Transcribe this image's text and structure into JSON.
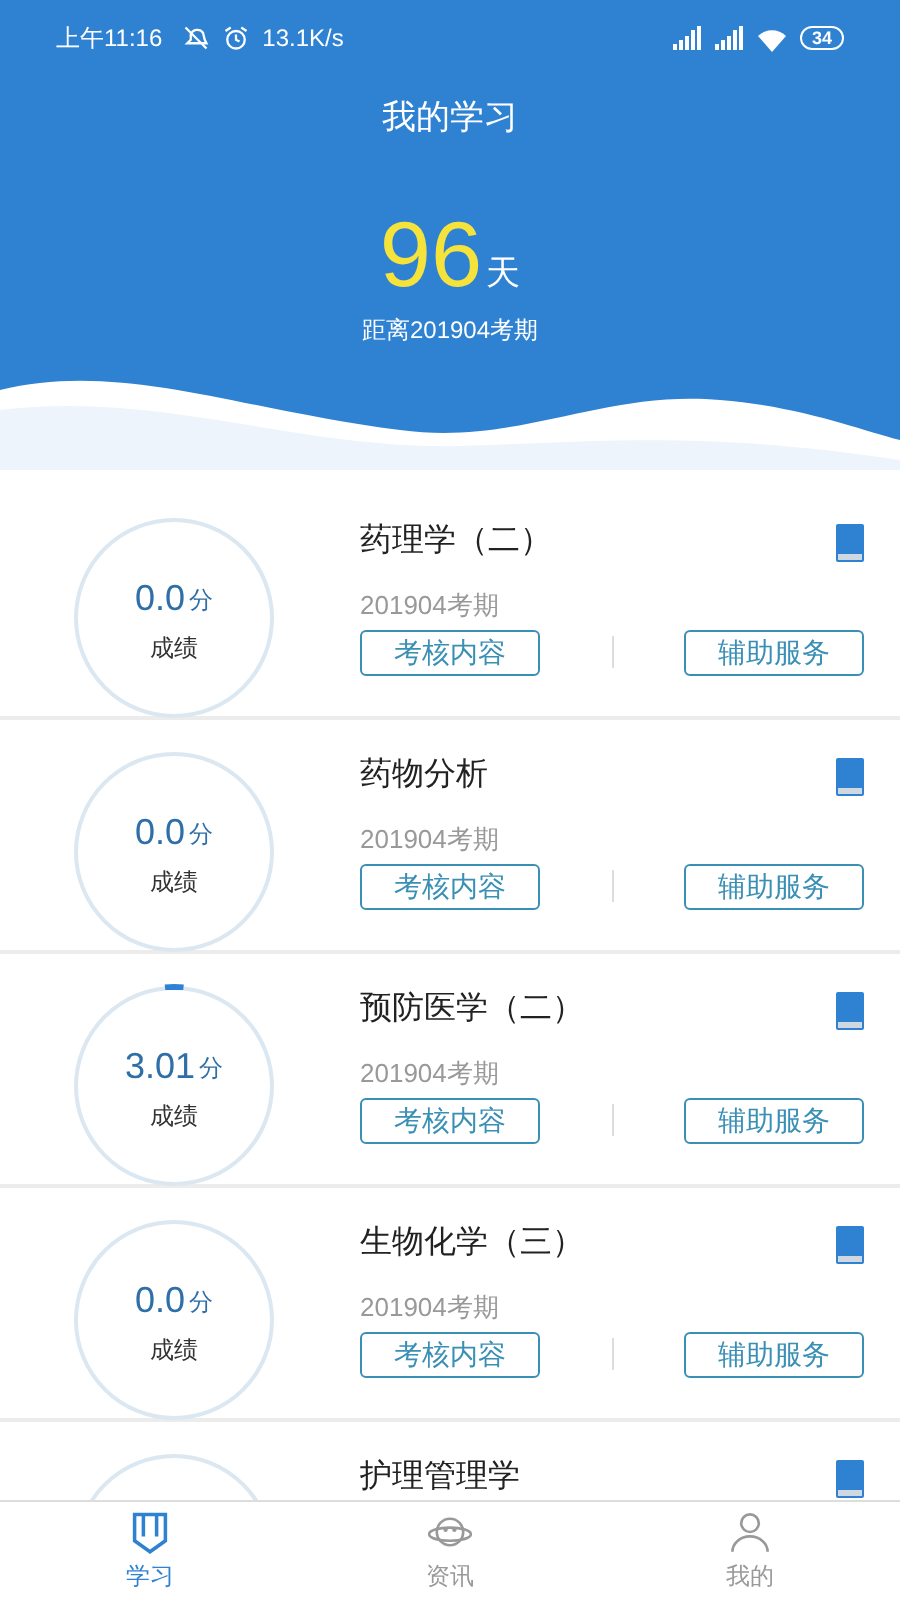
{
  "status_bar": {
    "time": "上午11:16",
    "speed": "13.1K/s",
    "battery": "34"
  },
  "header": {
    "title": "我的学习",
    "days": "96",
    "days_unit": "天",
    "caption": "距离201904考期"
  },
  "courses": [
    {
      "name": "药理学（二）",
      "score": "0.0",
      "score_unit": "分",
      "score_label": "成绩",
      "term": "201904考期",
      "buttons": [
        "考核内容",
        "辅助服务"
      ]
    },
    {
      "name": "药物分析",
      "score": "0.0",
      "score_unit": "分",
      "score_label": "成绩",
      "term": "201904考期",
      "buttons": [
        "考核内容",
        "辅助服务"
      ]
    },
    {
      "name": "预防医学（二）",
      "score": "3.01",
      "score_unit": "分",
      "score_label": "成绩",
      "term": "201904考期",
      "buttons": [
        "考核内容",
        "辅助服务"
      ]
    },
    {
      "name": "生物化学（三）",
      "score": "0.0",
      "score_unit": "分",
      "score_label": "成绩",
      "term": "201904考期",
      "buttons": [
        "考核内容",
        "辅助服务"
      ]
    },
    {
      "name": "护理管理学"
    }
  ],
  "tabs": [
    {
      "label": "学习",
      "kind": "study",
      "selected": true
    },
    {
      "label": "资讯",
      "kind": "news",
      "selected": false
    },
    {
      "label": "我的",
      "kind": "me",
      "selected": false
    }
  ]
}
